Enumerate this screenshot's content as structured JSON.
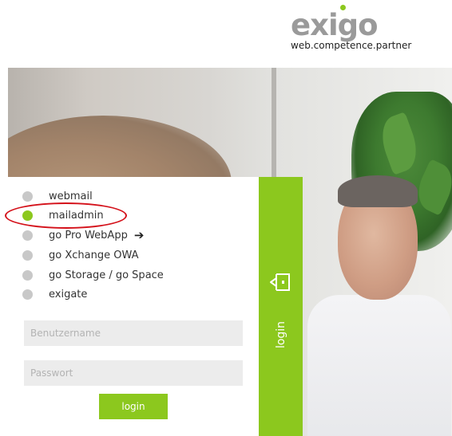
{
  "brand": {
    "logo_text": "exigo",
    "tagline": "web.competence.partner",
    "accent_color": "#8cc81e",
    "logo_gray": "#9a9a9a"
  },
  "menu": {
    "items": [
      {
        "label": "webmail",
        "active": false
      },
      {
        "label": "mailadmin",
        "active": true
      },
      {
        "label": "go Pro WebApp",
        "active": false,
        "icon": "arrow-right-icon",
        "icon_glyph": "➔"
      },
      {
        "label": "go Xchange OWA",
        "active": false
      },
      {
        "label": "go Storage / go Space",
        "active": false
      },
      {
        "label": "exigate",
        "active": false
      }
    ]
  },
  "form": {
    "username_placeholder": "Benutzername",
    "password_placeholder": "Passwort",
    "submit_label": "login"
  },
  "side_tab": {
    "label": "login",
    "icon": "door-exit-icon"
  },
  "annotation": {
    "color": "#d4111a",
    "target": "mailadmin"
  }
}
